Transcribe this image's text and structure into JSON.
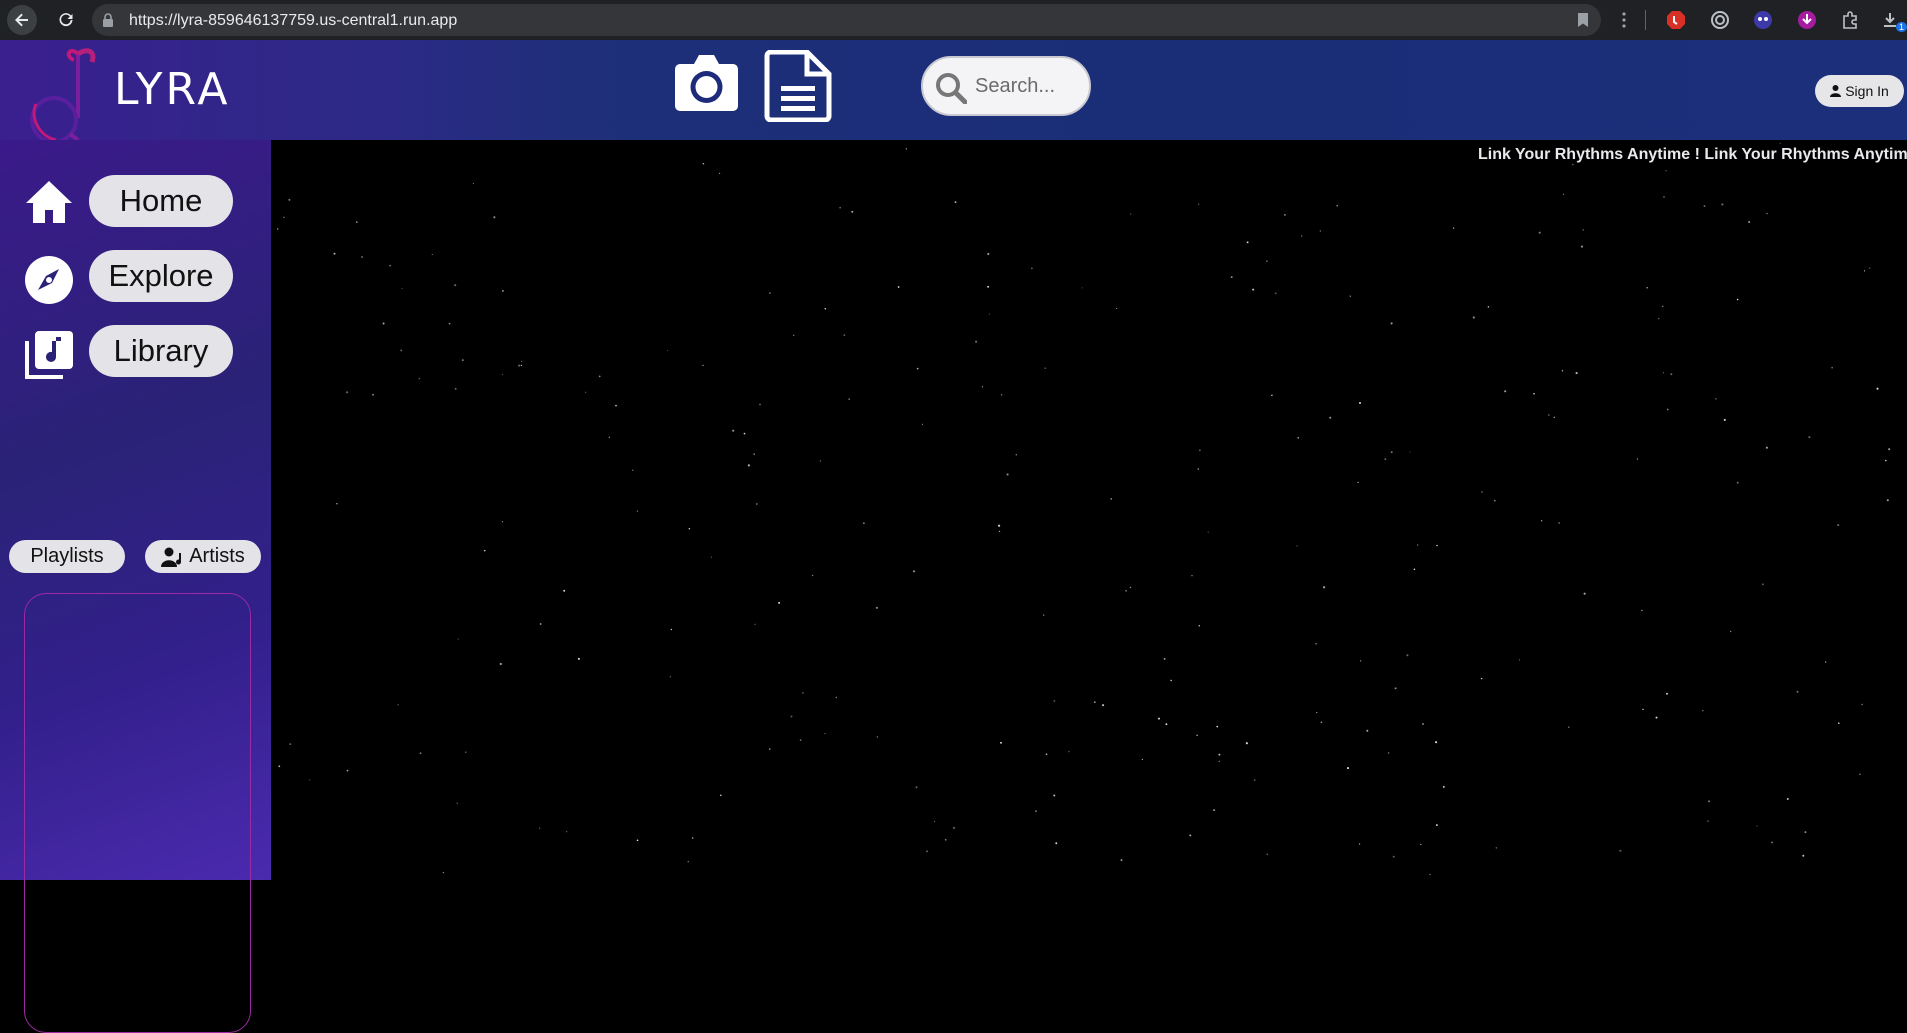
{
  "browser": {
    "url": "https://lyra-859646137759.us-central1.run.app",
    "icons": [
      "back-arrow-icon",
      "reload-icon",
      "lock-icon",
      "bookmark-icon",
      "more-vert-icon",
      "extension-icons",
      "download-icon"
    ],
    "download_badge": "1"
  },
  "header": {
    "logo_text": "LYRA",
    "search_placeholder": "Search...",
    "signin_label": "Sign In",
    "colors": {
      "bg_start": "#3a1f8f",
      "bg_end": "#1b2f7a"
    }
  },
  "sidebar": {
    "nav": [
      {
        "label": "Home",
        "icon": "home-icon"
      },
      {
        "label": "Explore",
        "icon": "compass-icon"
      },
      {
        "label": "Library",
        "icon": "music-library-icon"
      }
    ],
    "sub_tabs": [
      {
        "label": "Playlists"
      },
      {
        "label": "Artists",
        "icon": "user-music-icon"
      }
    ]
  },
  "main": {
    "marquee_text": "Link Your Rhythms Anytime ! Link Your Rhythms Anytime ! Li",
    "background": "#000000"
  }
}
